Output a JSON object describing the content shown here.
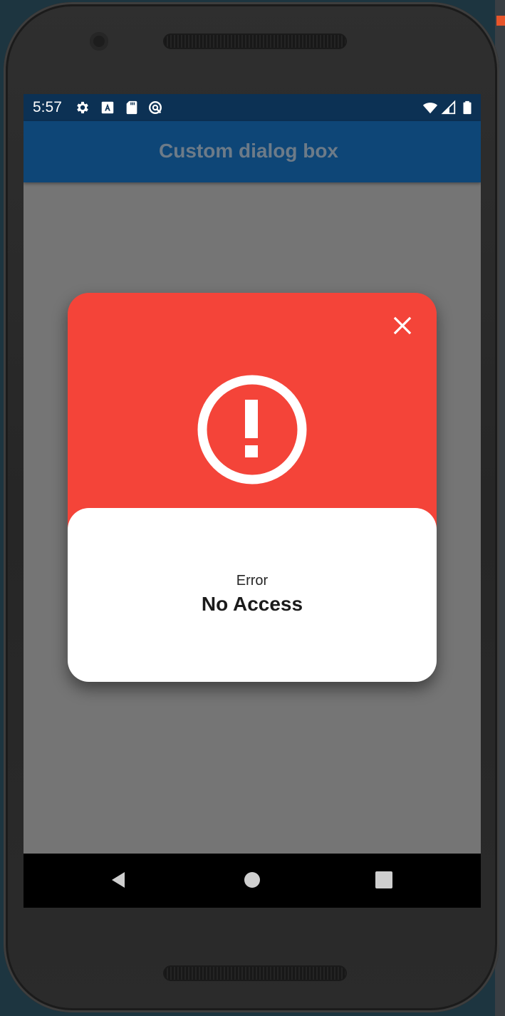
{
  "status_bar": {
    "time": "5:57",
    "left_icons": [
      "settings-icon",
      "a-notification-icon",
      "sd-card-icon",
      "data-saver-icon"
    ],
    "right_icons": [
      "wifi-icon",
      "signal-icon",
      "battery-icon"
    ]
  },
  "app_bar": {
    "title": "Custom dialog box"
  },
  "dialog": {
    "header_icon": "error-alert-icon",
    "close_icon": "close-icon",
    "label": "Error",
    "message": "No Access",
    "colors": {
      "header": "#f44439",
      "body": "#ffffff"
    }
  },
  "nav_bar": {
    "buttons": [
      "back-icon",
      "home-icon",
      "recents-icon"
    ]
  },
  "colors": {
    "status_bar": "#0c3154",
    "app_bar": "#0e4677",
    "scrim": "#757575"
  }
}
